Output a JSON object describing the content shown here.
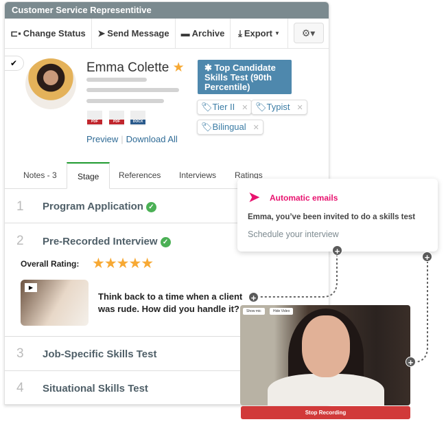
{
  "header": {
    "title": "Customer Service Representitive"
  },
  "toolbar": {
    "change_status": "Change Status",
    "send_message": "Send Message",
    "archive": "Archive",
    "export": "Export"
  },
  "candidate": {
    "name": "Emma Colette",
    "files": [
      "PDF",
      "PDF",
      "DOCX"
    ],
    "preview": "Preview",
    "download_all": "Download All",
    "badge": "✱ Top Candidate Skills Test (90th Percentile)",
    "tags": [
      "Tier II",
      "Typist",
      "Bilingual"
    ]
  },
  "tabs": [
    "Notes - 3",
    "Stage",
    "References",
    "Interviews",
    "Ratings"
  ],
  "stages": [
    {
      "num": "1",
      "title": "Program Application",
      "done": true
    },
    {
      "num": "2",
      "title": "Pre-Recorded Interview",
      "done": true
    },
    {
      "num": "3",
      "title": "Job-Specific Skills Test",
      "done": false
    },
    {
      "num": "4",
      "title": "Situational Skills Test",
      "done": false
    }
  ],
  "interview": {
    "rating_label": "Overall Rating:",
    "rating": 5,
    "question": "Think back to a time when a client was rude. How did you handle it?"
  },
  "email_card": {
    "title": "Automatic emails",
    "subject": "Emma, you’ve been invited to do a skills test",
    "body": "Schedule your interview",
    "accent": "#e8136f"
  },
  "video": {
    "show_mic": "Show mic",
    "hide_video": "Hide Video",
    "stop": "Stop Recording"
  }
}
